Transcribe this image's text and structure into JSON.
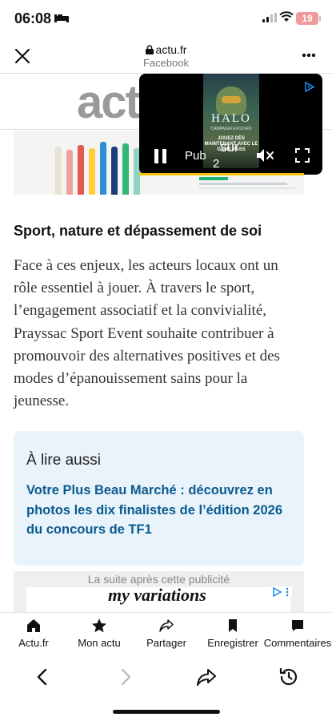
{
  "status_bar": {
    "time": "06:08",
    "battery": "19"
  },
  "browser": {
    "domain": "actu.fr",
    "source": "Facebook"
  },
  "logo": {
    "text": "act"
  },
  "video_ad": {
    "title": "HALO",
    "subtitle": "CAMPAIGN EVOLVED",
    "promo": "JOUEZ DÈS MAINTENANT AVEC LE GAME PASS",
    "label": "Pub",
    "overlay_word": "sur",
    "counter": "2",
    "progress": 0.9
  },
  "article": {
    "heading": "Sport, nature et dépassement de soi",
    "paragraph": "Face à ces enjeux, les acteurs locaux ont un rôle essentiel à jouer. À travers le sport, l’engagement associatif et la convivialité, Prayssac Sport Event souhaite contribuer à promouvoir des alternatives positives et des modes d’épanouissement sains pour la jeunesse."
  },
  "read_also": {
    "title": "À lire aussi",
    "link": "Votre Plus Beau Marché : découvrez en photos les dix finalistes de l’édition 2026 du concours de TF1"
  },
  "bottom_ad": {
    "caption": "La suite après cette publicité",
    "brand": "my variations"
  },
  "tabs": [
    {
      "label": "Actu.fr",
      "icon": "home-icon"
    },
    {
      "label": "Mon actu",
      "icon": "star-icon"
    },
    {
      "label": "Partager",
      "icon": "share-icon"
    },
    {
      "label": "Enregistrer",
      "icon": "bookmark-icon"
    },
    {
      "label": "Commentaires",
      "icon": "comment-icon"
    }
  ],
  "nav": [
    "back-icon",
    "forward-icon",
    "share-forward-icon",
    "history-icon"
  ],
  "colors": {
    "link": "#0b5a8e",
    "read_also_bg": "#e8f3fb",
    "progress": "#f2c200"
  }
}
